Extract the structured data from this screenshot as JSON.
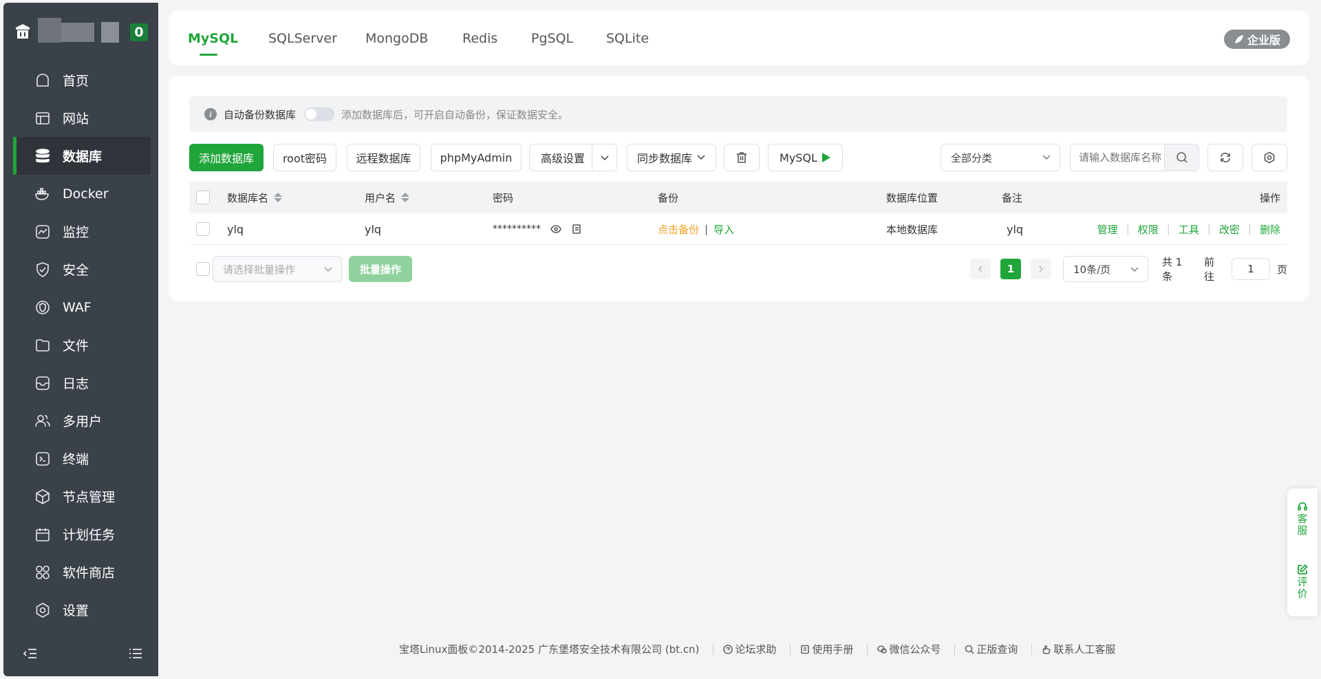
{
  "sidebar": {
    "badge": "0",
    "items": [
      {
        "label": "首页",
        "icon": "home-icon"
      },
      {
        "label": "网站",
        "icon": "globe-window-icon"
      },
      {
        "label": "数据库",
        "icon": "database-icon",
        "active": true
      },
      {
        "label": "Docker",
        "icon": "docker-icon"
      },
      {
        "label": "监控",
        "icon": "monitor-chart-icon"
      },
      {
        "label": "安全",
        "icon": "shield-icon"
      },
      {
        "label": "WAF",
        "icon": "waf-icon"
      },
      {
        "label": "文件",
        "icon": "folder-icon"
      },
      {
        "label": "日志",
        "icon": "log-icon"
      },
      {
        "label": "多用户",
        "icon": "users-icon"
      },
      {
        "label": "终端",
        "icon": "terminal-icon"
      },
      {
        "label": "节点管理",
        "icon": "cube-icon"
      },
      {
        "label": "计划任务",
        "icon": "calendar-icon"
      },
      {
        "label": "软件商店",
        "icon": "apps-icon"
      },
      {
        "label": "设置",
        "icon": "settings-icon"
      }
    ]
  },
  "tabs": [
    "MySQL",
    "SQLServer",
    "MongoDB",
    "Redis",
    "PgSQL",
    "SQLite"
  ],
  "enterprise_label": "企业版",
  "notice": {
    "title": "自动备份数据库",
    "hint": "添加数据库后，可开启自动备份，保证数据安全。"
  },
  "toolbar": {
    "add_db": "添加数据库",
    "root_pwd": "root密码",
    "remote_db": "远程数据库",
    "phpmyadmin": "phpMyAdmin",
    "advanced": "高级设置",
    "sync_db": "同步数据库",
    "mysql_run": "MySQL",
    "category": "全部分类",
    "search_placeholder": "请输入数据库名称"
  },
  "table": {
    "headers": {
      "name": "数据库名",
      "user": "用户名",
      "password": "密码",
      "backup": "备份",
      "location": "数据库位置",
      "remark": "备注",
      "ops": "操作"
    },
    "rows": [
      {
        "name": "ylq",
        "user": "ylq",
        "password": "**********",
        "backup_action": "点击备份",
        "import_action": "导入",
        "location": "本地数据库",
        "remark": "ylq",
        "ops": [
          "管理",
          "权限",
          "工具",
          "改密",
          "删除"
        ]
      }
    ]
  },
  "bulk": {
    "placeholder": "请选择批量操作",
    "button": "批量操作"
  },
  "pager": {
    "current": "1",
    "page_size": "10条/页",
    "total": "共 1 条",
    "goto": "前往",
    "goto_value": "1",
    "page_unit": "页"
  },
  "footer": {
    "copyright": "宝塔Linux面板©2014-2025 广东堡塔安全技术有限公司 (bt.cn)",
    "links": [
      "论坛求助",
      "使用手册",
      "微信公众号",
      "正版查询",
      "联系人工客服"
    ]
  },
  "float_panel": {
    "service": [
      "客",
      "服"
    ],
    "review": [
      "评",
      "价"
    ]
  },
  "colors": {
    "accent": "#20a53a",
    "sidebar_bg": "#3b4149",
    "warning": "#f0a020"
  }
}
